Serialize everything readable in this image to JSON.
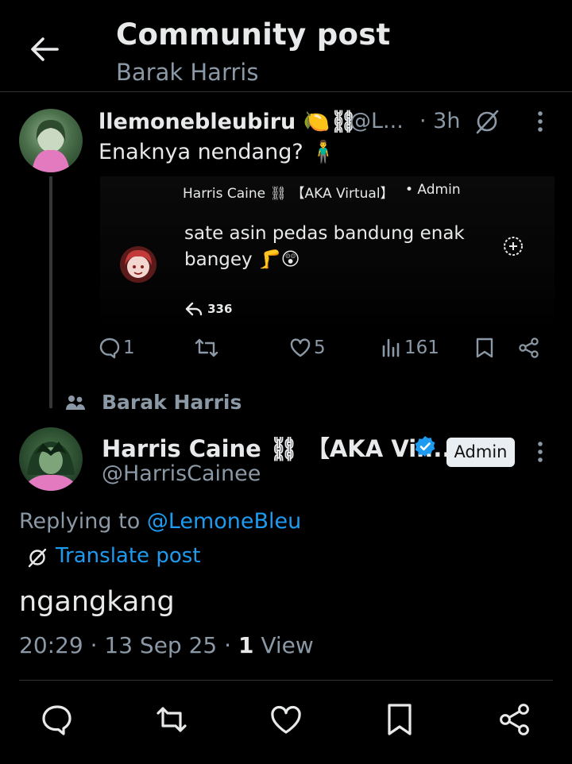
{
  "header": {
    "title": "Community post",
    "subtitle": "Barak Harris"
  },
  "post1": {
    "display_name": "llemonebleubiru",
    "handle": "@L...",
    "time": "· 3h",
    "text": "Enaknya nendang? 🧍‍♂️",
    "embed": {
      "name": "Harris Caine ⛓ 【AKA Virtual】",
      "role": "• Admin",
      "text_line1": "sate asin pedas bandung enak",
      "text_line2": "bangey 🦵😲",
      "shares": "336"
    },
    "actions": {
      "replies": "1",
      "likes": "5",
      "views": "161"
    }
  },
  "context": {
    "label": "Barak Harris"
  },
  "post2": {
    "display_name": "Harris Caine ⛓ 【AKA Vir...",
    "badge": "Admin",
    "handle": "@HarrisCainee",
    "replying_prefix": "Replying to ",
    "replying_to": "@LemoneBleu",
    "translate": "Translate post",
    "text": "ngangkang",
    "time": "20:29 · 13 Sep 25 · ",
    "views_count": "1",
    "views_label": " View"
  },
  "colors": {
    "accent": "#1d9bf0",
    "muted": "#8b98a5",
    "text": "#e7e9ea",
    "verified": "#1d9bf0"
  },
  "icons": [
    "back-arrow-icon",
    "reply-icon",
    "retweet-icon",
    "like-icon",
    "views-icon",
    "bookmark-icon",
    "share-icon",
    "translate-icon",
    "more-icon",
    "community-icon",
    "verified-icon",
    "add-icon"
  ]
}
